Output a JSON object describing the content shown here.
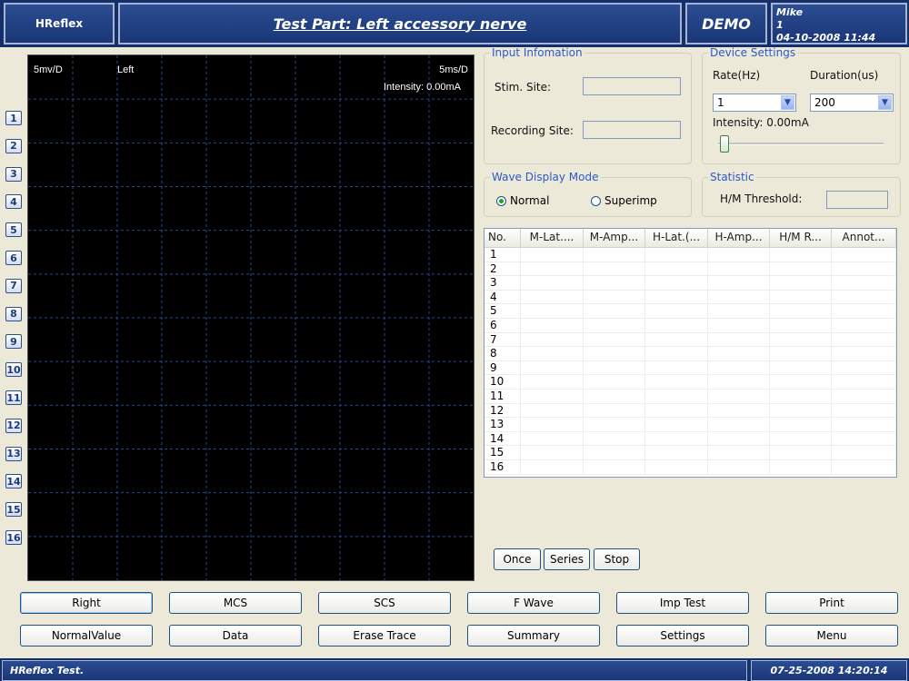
{
  "header": {
    "app_name": "HReflex",
    "title": "Test Part: Left accessory nerve",
    "demo": "DEMO",
    "user_name": "Mike",
    "user_id": "1",
    "user_datetime": "04-10-2008 11:44"
  },
  "scope": {
    "scale_y": "5mv/D",
    "side": "Left",
    "scale_x": "5ms/D",
    "intensity": "Intensity:  0.00mA"
  },
  "channels": [
    "1",
    "2",
    "3",
    "4",
    "5",
    "6",
    "7",
    "8",
    "9",
    "10",
    "11",
    "12",
    "13",
    "14",
    "15",
    "16"
  ],
  "input_info": {
    "legend": "Input Infomation",
    "stim_site_label": "Stim. Site:",
    "stim_site_value": "",
    "recording_site_label": "Recording Site:",
    "recording_site_value": ""
  },
  "device_settings": {
    "legend": "Device Settings",
    "rate_label": "Rate(Hz)",
    "duration_label": "Duration(us)",
    "rate_value": "1",
    "duration_value": "200",
    "intensity_label": "Intensity:  0.00mA",
    "intensity_level": 0
  },
  "wave_display": {
    "legend": "Wave Display Mode",
    "normal": "Normal",
    "superimp": "Superimp",
    "selected": "Normal"
  },
  "statistic": {
    "legend": "Statistic",
    "threshold_label": "H/M Threshold:",
    "threshold_value": ""
  },
  "table": {
    "columns": [
      "No.",
      "M-Lat....",
      "M-Amp...",
      "H-Lat.(...",
      "H-Amp...",
      "H/M R...",
      "Annot..."
    ],
    "rows": [
      "1",
      "2",
      "3",
      "4",
      "5",
      "6",
      "7",
      "8",
      "9",
      "10",
      "11",
      "12",
      "13",
      "14",
      "15",
      "16"
    ]
  },
  "acq_buttons": {
    "once": "Once",
    "series": "Series",
    "stop": "Stop"
  },
  "bottom_buttons": {
    "row1": [
      "Right",
      "MCS",
      "SCS",
      "F Wave",
      "Imp Test",
      "Print"
    ],
    "row2": [
      "NormalValue",
      "Data",
      "Erase Trace",
      "Summary",
      "Settings",
      "Menu"
    ]
  },
  "status": {
    "left": "HReflex Test.",
    "right": "07-25-2008  14:20:14"
  }
}
